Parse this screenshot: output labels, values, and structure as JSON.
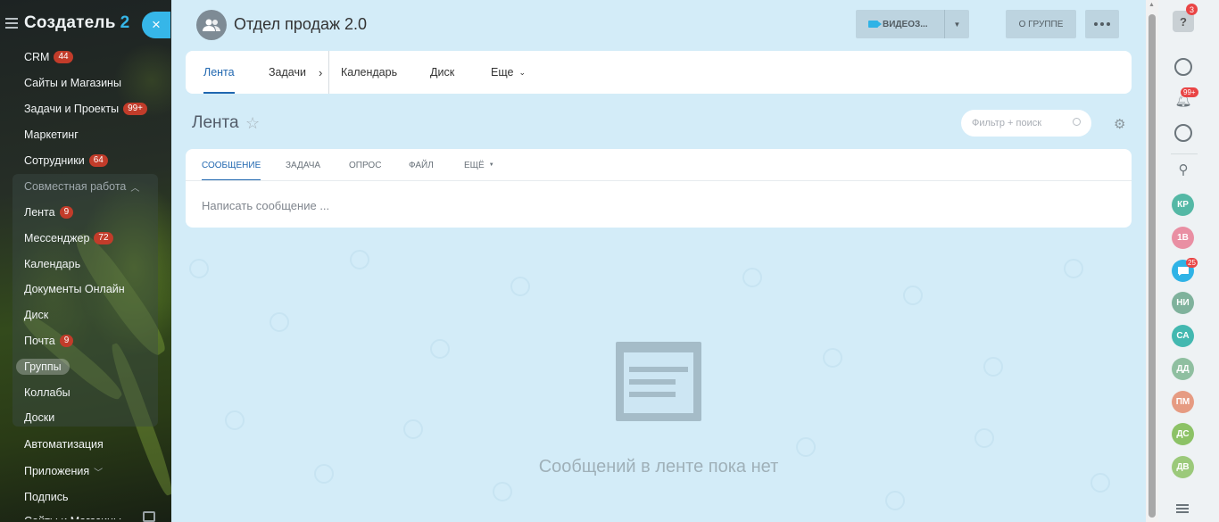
{
  "sidebar": {
    "logo": "Создатель",
    "logo_num": "2",
    "close_glyph": "×",
    "items": [
      {
        "label": "CRM",
        "badge": "44"
      },
      {
        "label": "Сайты и Магазины",
        "badge": ""
      },
      {
        "label": "Задачи и Проекты",
        "badge": "99+"
      },
      {
        "label": "Маркетинг",
        "badge": ""
      },
      {
        "label": "Сотрудники",
        "badge": "64"
      }
    ],
    "section_label": "Совместная работа",
    "group_items": [
      {
        "label": "Лента",
        "badge": "9"
      },
      {
        "label": "Мессенджер",
        "badge": "72"
      },
      {
        "label": "Календарь",
        "badge": ""
      },
      {
        "label": "Документы Онлайн",
        "badge": ""
      },
      {
        "label": "Диск",
        "badge": ""
      },
      {
        "label": "Почта",
        "badge": "9"
      },
      {
        "label": "Группы",
        "badge": ""
      },
      {
        "label": "Коллабы",
        "badge": ""
      },
      {
        "label": "Доски",
        "badge": ""
      }
    ],
    "bottom_items": [
      {
        "label": "Автоматизация"
      },
      {
        "label": "Приложения"
      },
      {
        "label": "Подпись"
      },
      {
        "label": "Сайты и Магазины"
      }
    ]
  },
  "header": {
    "group_title": "Отдел продаж 2.0",
    "video_label": "ВИДЕОЗ...",
    "about_label": "О ГРУППЕ"
  },
  "top_tabs": [
    {
      "label": "Лента"
    },
    {
      "label": "Задачи"
    },
    {
      "label": "Календарь"
    },
    {
      "label": "Диск"
    },
    {
      "label": "Еще"
    }
  ],
  "page": {
    "title": "Лента",
    "filter_placeholder": "Фильтр + поиск"
  },
  "post": {
    "tabs": [
      {
        "label": "СООБЩЕНИЕ"
      },
      {
        "label": "ЗАДАЧА"
      },
      {
        "label": "ОПРОС"
      },
      {
        "label": "ФАЙЛ"
      },
      {
        "label": "ЕЩЁ"
      }
    ],
    "placeholder": "Написать сообщение ..."
  },
  "empty_state": {
    "text": "Сообщений в ленте пока нет"
  },
  "right_rail": {
    "help_badge": "3",
    "notif_badge": "99+",
    "avatars": [
      {
        "initials": "КР",
        "color": "#54b8a5"
      },
      {
        "initials": "1В",
        "color": "#e98fa3"
      },
      {
        "initials": "",
        "color": "#2fb3e6",
        "badge": "25"
      },
      {
        "initials": "НИ",
        "color": "#7fb29c"
      },
      {
        "initials": "СА",
        "color": "#43b8b0"
      },
      {
        "initials": "ДД",
        "color": "#8fbfa0"
      },
      {
        "initials": "ПМ",
        "color": "#e69b82"
      },
      {
        "initials": "ДС",
        "color": "#8cc266"
      },
      {
        "initials": "ДВ",
        "color": "#9bc97a"
      }
    ]
  },
  "colors": {
    "accent": "#36b6e8",
    "link": "#2067b0",
    "badge": "#c23c2a"
  }
}
